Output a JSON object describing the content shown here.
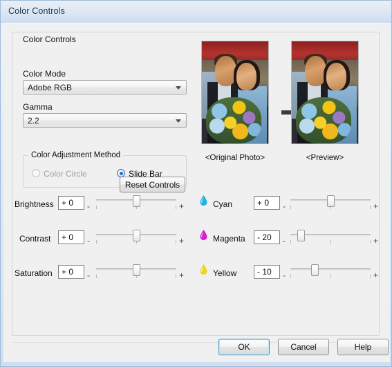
{
  "window": {
    "title": "Color Controls"
  },
  "group": {
    "legend": "Color Controls"
  },
  "color_mode": {
    "label": "Color Mode",
    "value": "Adobe RGB",
    "arrow_icon": "chevron-down-icon"
  },
  "gamma": {
    "label": "Gamma",
    "value": "2.2",
    "arrow_icon": "chevron-down-icon"
  },
  "adjustment_method": {
    "legend": "Color Adjustment Method",
    "options": [
      {
        "label": "Color Circle",
        "selected": false,
        "disabled": true
      },
      {
        "label": "Slide Bar",
        "selected": true,
        "disabled": false
      }
    ]
  },
  "preview": {
    "original_caption": "<Original Photo>",
    "preview_caption": "<Preview>",
    "arrow_icon": "arrow-right-icon"
  },
  "reset_button": {
    "label": "Reset Controls"
  },
  "sliders": {
    "minus_sign": "-",
    "plus_sign": "+",
    "left_column": [
      {
        "label": "Brightness",
        "value": "+ 0",
        "position": 50,
        "icon": null
      },
      {
        "label": "Contrast",
        "value": "+ 0",
        "position": 50,
        "icon": null
      },
      {
        "label": "Saturation",
        "value": "+ 0",
        "position": 50,
        "icon": null
      }
    ],
    "right_column": [
      {
        "label": "Cyan",
        "value": "+ 0",
        "position": 50,
        "icon": "ink-drop-cyan-icon",
        "color": "#22b3e0"
      },
      {
        "label": "Magenta",
        "value": "- 20",
        "position": 13,
        "icon": "ink-drop-magenta-icon",
        "color": "#d61fd1"
      },
      {
        "label": "Yellow",
        "value": "- 10",
        "position": 30,
        "icon": "ink-drop-yellow-icon",
        "color": "#f0d328"
      }
    ]
  },
  "buttons": {
    "ok": "OK",
    "cancel": "Cancel",
    "help": "Help"
  },
  "colors": {
    "accent": "#3c94c8",
    "title_text": "#17334f",
    "dialog_bg": "#f0f0f0"
  }
}
